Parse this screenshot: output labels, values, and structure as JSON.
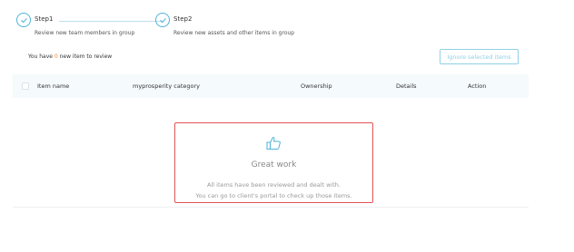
{
  "stepper": {
    "steps": [
      {
        "title": "Step1",
        "description": "Review new team members in group"
      },
      {
        "title": "Step2",
        "description": "Review new assets and other items in group"
      }
    ]
  },
  "review": {
    "prefix": "You have ",
    "count": "0",
    "suffix": " new item to review"
  },
  "ignore_button_label": "Ignore selected items",
  "table": {
    "columns": [
      "Item name",
      "myprosperity category",
      "Ownership",
      "Details",
      "Action"
    ]
  },
  "empty_state": {
    "icon": "thumbs-up-icon",
    "title": "Great work",
    "line1": "All items have been reviewed and dealt with.",
    "line2": "You can go to client's portal to check up those items."
  },
  "colors": {
    "accent": "#4fb3d6",
    "count": "#f28c28",
    "highlight_border": "#e05353"
  }
}
